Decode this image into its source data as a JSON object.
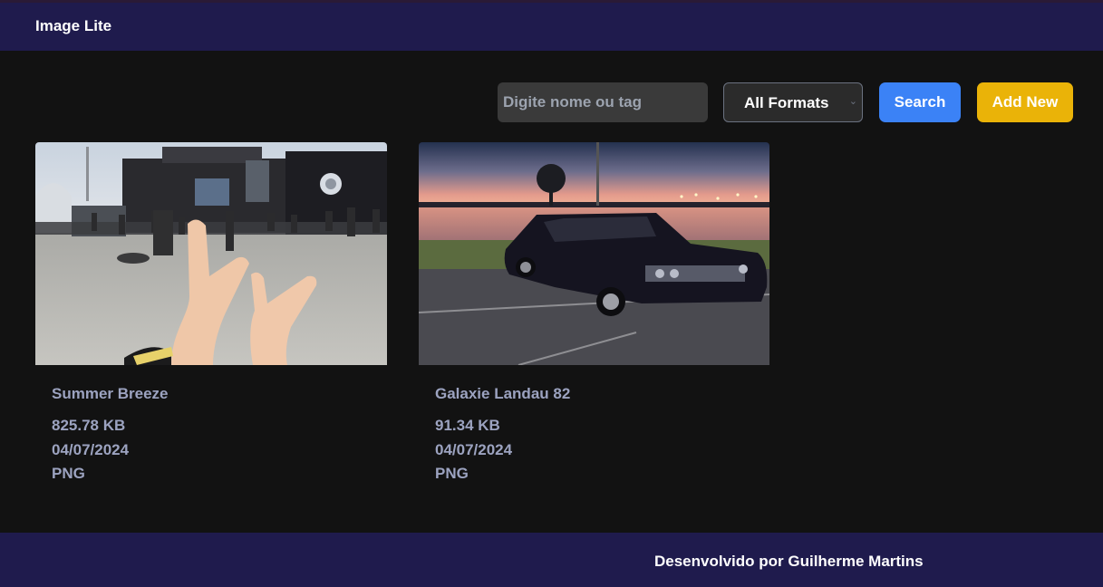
{
  "header": {
    "title": "Image Lite"
  },
  "toolbar": {
    "search_placeholder": "Digite nome ou tag",
    "search_value": "",
    "format_selected": "All Formats",
    "search_label": "Search",
    "add_label": "Add New"
  },
  "colors": {
    "header_bg": "#1f1b4d",
    "page_bg": "#121212",
    "search_button": "#3b82f6",
    "add_button": "#eab308",
    "card_text": "#9ca3c0"
  },
  "gallery": {
    "items": [
      {
        "name": "Summer Breeze",
        "size": "825.78 KB",
        "date": "04/07/2024",
        "extension": "PNG",
        "image": "concert-crowd-photo"
      },
      {
        "name": "Galaxie Landau 82",
        "size": "91.34 KB",
        "date": "04/07/2024",
        "extension": "PNG",
        "image": "classic-car-sunset-photo"
      }
    ]
  },
  "footer": {
    "text": "Desenvolvido por Guilherme Martins"
  }
}
